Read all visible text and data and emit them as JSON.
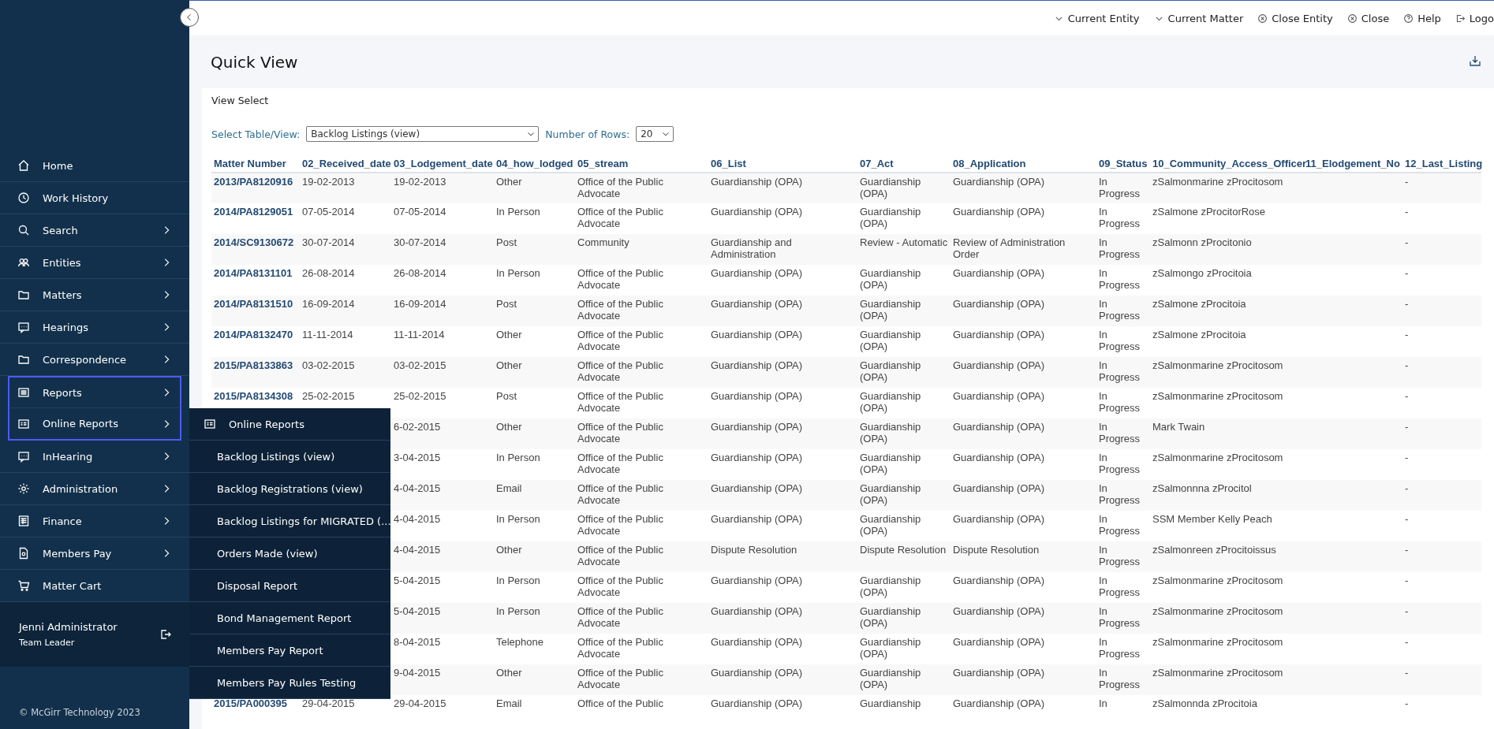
{
  "top_bar": {
    "items": [
      {
        "label": "Current Entity",
        "kind": "dropdown"
      },
      {
        "label": "Current Matter",
        "kind": "dropdown"
      },
      {
        "label": "Close Entity",
        "kind": "close"
      },
      {
        "label": "Close",
        "kind": "close"
      },
      {
        "label": "Help",
        "kind": "help"
      },
      {
        "label": "Logo",
        "kind": "logout"
      }
    ]
  },
  "sidebar": {
    "items": [
      {
        "label": "Home",
        "has_submenu": false,
        "outlined": false
      },
      {
        "label": "Work History",
        "has_submenu": false,
        "outlined": false
      },
      {
        "label": "Search",
        "has_submenu": true,
        "outlined": false
      },
      {
        "label": "Entities",
        "has_submenu": true,
        "outlined": false
      },
      {
        "label": "Matters",
        "has_submenu": true,
        "outlined": false
      },
      {
        "label": "Hearings",
        "has_submenu": true,
        "outlined": false
      },
      {
        "label": "Correspondence",
        "has_submenu": true,
        "outlined": false
      },
      {
        "label": "Reports",
        "has_submenu": true,
        "outlined": true
      },
      {
        "label": "Online Reports",
        "has_submenu": true,
        "outlined": true
      },
      {
        "label": "InHearing",
        "has_submenu": true,
        "outlined": false
      },
      {
        "label": "Administration",
        "has_submenu": true,
        "outlined": false
      },
      {
        "label": "Finance",
        "has_submenu": true,
        "outlined": false
      },
      {
        "label": "Members Pay",
        "has_submenu": true,
        "outlined": false
      },
      {
        "label": "Matter Cart",
        "has_submenu": false,
        "outlined": false
      }
    ],
    "user": {
      "name": "Jenni Administrator",
      "role": "Team Leader"
    },
    "footer": "© McGirr Technology 2023"
  },
  "flyout": {
    "title": "Online Reports",
    "items": [
      "Backlog Listings (view)",
      "Backlog Registrations (view)",
      "Backlog Listings for MIGRATED (...",
      "Orders Made (view)",
      "Disposal Report",
      "Bond Management Report",
      "Members Pay Report",
      "Members Pay Rules Testing"
    ]
  },
  "page": {
    "title": "Quick View",
    "section": "View Select",
    "table_select_label": "Select Table/View:",
    "table_select_value": "Backlog Listings (view)",
    "rows_label": "Number of Rows:",
    "rows_value": "20"
  },
  "table": {
    "columns": [
      "Matter Number",
      "02_Received_date",
      "03_Lodgement_date",
      "04_how_lodged",
      "05_stream",
      "06_List",
      "07_Act",
      "08_Application",
      "09_Status",
      "10_Community_Access_Officer",
      "11_Elodgement_No",
      "12_Last_Listing"
    ],
    "rows": [
      [
        "2013/PA8120916",
        "19-02-2013",
        "19-02-2013",
        "Other",
        "Office of the Public Advocate",
        "Guardianship (OPA)",
        "Guardianship (OPA)",
        "Guardianship (OPA)",
        "In Progress",
        "zSalmonmarine zProcitosom",
        null,
        "-"
      ],
      [
        "2014/PA8129051",
        "07-05-2014",
        "07-05-2014",
        "In Person",
        "Office of the Public Advocate",
        "Guardianship (OPA)",
        "Guardianship (OPA)",
        "Guardianship (OPA)",
        "In Progress",
        "zSalmone zProcitorRose",
        null,
        "-"
      ],
      [
        "2014/SC9130672",
        "30-07-2014",
        "30-07-2014",
        "Post",
        "Community",
        "Guardianship and Administration",
        "Review - Automatic",
        "Review of Administration Order",
        "In Progress",
        "zSalmonn zProcitonio",
        null,
        "-"
      ],
      [
        "2014/PA8131101",
        "26-08-2014",
        "26-08-2014",
        "In Person",
        "Office of the Public Advocate",
        "Guardianship (OPA)",
        "Guardianship (OPA)",
        "Guardianship (OPA)",
        "In Progress",
        "zSalmongo zProcitoia",
        null,
        "-"
      ],
      [
        "2014/PA8131510",
        "16-09-2014",
        "16-09-2014",
        "Post",
        "Office of the Public Advocate",
        "Guardianship (OPA)",
        "Guardianship (OPA)",
        "Guardianship (OPA)",
        "In Progress",
        "zSalmone zProcitoia",
        null,
        "-"
      ],
      [
        "2014/PA8132470",
        "11-11-2014",
        "11-11-2014",
        "Other",
        "Office of the Public Advocate",
        "Guardianship (OPA)",
        "Guardianship (OPA)",
        "Guardianship (OPA)",
        "In Progress",
        "zSalmone zProcitoia",
        null,
        "-"
      ],
      [
        "2015/PA8133863",
        "03-02-2015",
        "03-02-2015",
        "Other",
        "Office of the Public Advocate",
        "Guardianship (OPA)",
        "Guardianship (OPA)",
        "Guardianship (OPA)",
        "In Progress",
        "zSalmonmarine zProcitosom",
        null,
        "-"
      ],
      [
        "2015/PA8134308",
        "25-02-2015",
        "25-02-2015",
        "Post",
        "Office of the Public Advocate",
        "Guardianship (OPA)",
        "Guardianship (OPA)",
        "Guardianship (OPA)",
        "In Progress",
        "zSalmonmarine zProcitosom",
        null,
        "-"
      ],
      [
        null,
        null,
        "6-02-2015",
        "Other",
        "Office of the Public Advocate",
        "Guardianship (OPA)",
        "Guardianship (OPA)",
        "Guardianship (OPA)",
        "In Progress",
        "Mark Twain",
        null,
        "-"
      ],
      [
        null,
        null,
        "3-04-2015",
        "In Person",
        "Office of the Public Advocate",
        "Guardianship (OPA)",
        "Guardianship (OPA)",
        "Guardianship (OPA)",
        "In Progress",
        "zSalmonmarine zProcitosom",
        null,
        "-"
      ],
      [
        null,
        null,
        "4-04-2015",
        "Email",
        "Office of the Public Advocate",
        "Guardianship (OPA)",
        "Guardianship (OPA)",
        "Guardianship (OPA)",
        "In Progress",
        "zSalmonnna zProcitol",
        null,
        "-"
      ],
      [
        null,
        null,
        "4-04-2015",
        "In Person",
        "Office of the Public Advocate",
        "Guardianship (OPA)",
        "Guardianship (OPA)",
        "Guardianship (OPA)",
        "In Progress",
        "SSM Member Kelly Peach",
        null,
        "-"
      ],
      [
        null,
        null,
        "4-04-2015",
        "Other",
        "Office of the Public Advocate",
        "Dispute Resolution",
        "Dispute Resolution",
        "Dispute Resolution",
        "In Progress",
        "zSalmonreen zProcitoissus",
        null,
        "-"
      ],
      [
        null,
        null,
        "5-04-2015",
        "In Person",
        "Office of the Public Advocate",
        "Guardianship (OPA)",
        "Guardianship (OPA)",
        "Guardianship (OPA)",
        "In Progress",
        "zSalmonmarine zProcitosom",
        null,
        "-"
      ],
      [
        null,
        null,
        "5-04-2015",
        "In Person",
        "Office of the Public Advocate",
        "Guardianship (OPA)",
        "Guardianship (OPA)",
        "Guardianship (OPA)",
        "In Progress",
        "zSalmonmarine zProcitosom",
        null,
        "-"
      ],
      [
        null,
        null,
        "8-04-2015",
        "Telephone",
        "Office of the Public Advocate",
        "Guardianship (OPA)",
        "Guardianship (OPA)",
        "Guardianship (OPA)",
        "In Progress",
        "zSalmonmarine zProcitosom",
        null,
        "-"
      ],
      [
        null,
        null,
        "9-04-2015",
        "Other",
        "Office of the Public Advocate",
        "Guardianship (OPA)",
        "Guardianship (OPA)",
        "Guardianship (OPA)",
        "In Progress",
        "zSalmonmarine zProcitosom",
        null,
        "-"
      ],
      [
        "2015/PA000395",
        "29-04-2015",
        "29-04-2015",
        "Email",
        "Office of the Public",
        "Guardianship (OPA)",
        "Guardianship",
        "Guardianship (OPA)",
        "In",
        "zSalmonnda zProcitoia",
        null,
        "-"
      ]
    ]
  }
}
